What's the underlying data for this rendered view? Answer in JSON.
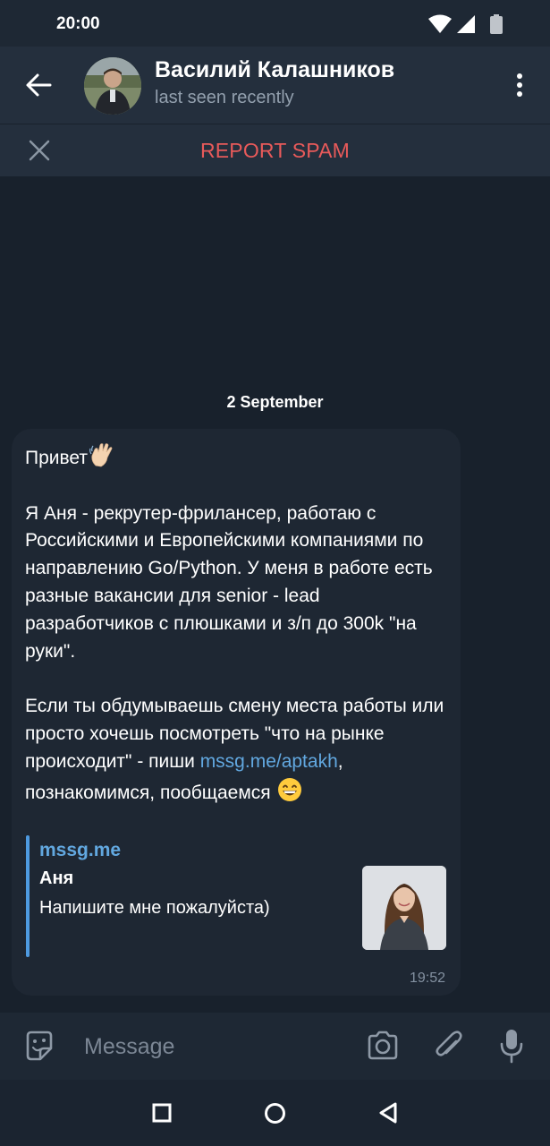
{
  "status_bar": {
    "time": "20:00",
    "icons": [
      "wifi-icon",
      "cellular-signal-icon",
      "battery-icon"
    ]
  },
  "header": {
    "contact_name": "Василий Калашников",
    "contact_status": "last seen recently",
    "icons": [
      "back-arrow-icon",
      "more-vertical-icon"
    ]
  },
  "spam_bar": {
    "label": "REPORT SPAM",
    "label_color": "#e85a5a"
  },
  "chat": {
    "date": "2 September",
    "message": {
      "greeting": "Привет",
      "greeting_emoji": "waving-hand-emoji",
      "paragraph2": "Я Аня - рекрутер-фрилансер, работаю с Российскими и Европейскими компаниями по направлению Go/Python. У меня в работе есть разные вакансии для senior - lead разработчиков с плюшками и з/п до 300k \"на руки\".",
      "paragraph3_before_link": "Если ты обдумываешь смену места работы или просто хочешь посмотреть \"что на рынке происходит\" - пиши ",
      "link_text": "mssg.me/aptakh",
      "paragraph3_after_link": ", познакомимся, пообщаемся",
      "closing_emoji": "grinning-face-emoji",
      "time": "19:52"
    },
    "link_preview": {
      "site": "mssg.me",
      "title": "Аня",
      "description": "Напишите мне пожалуйста)"
    }
  },
  "input_bar": {
    "placeholder": "Message",
    "icons": [
      "sticker-icon",
      "camera-icon",
      "attach-icon",
      "microphone-icon"
    ]
  },
  "nav_bar": {
    "icons": [
      "recents-icon",
      "home-icon",
      "back-icon"
    ]
  },
  "colors": {
    "background": "#18212c",
    "header": "#242f3d",
    "bubble": "#1e2733",
    "link": "#62a8e0",
    "accent_bar": "#4e9ae0"
  }
}
